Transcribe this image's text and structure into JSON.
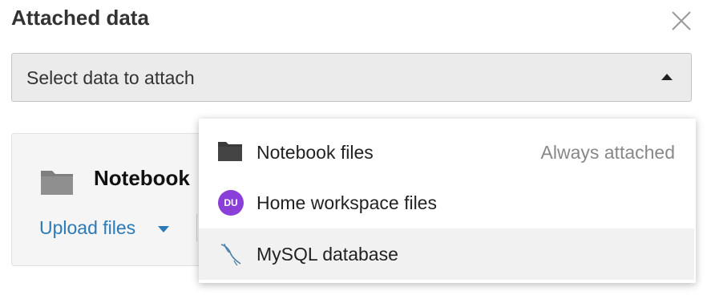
{
  "dialog": {
    "title": "Attached data",
    "close_icon": "close-icon"
  },
  "select": {
    "label": "Select data to attach",
    "caret_icon": "caret-up-icon"
  },
  "card": {
    "title": "Notebook",
    "icon": "folder-icon",
    "upload_label": "Upload files",
    "upload_caret_icon": "caret-down-icon"
  },
  "menu": {
    "items": [
      {
        "label": "Notebook files",
        "aside": "Always attached",
        "icon": "folder-icon"
      },
      {
        "label": "Home workspace files",
        "avatar": "DU",
        "avatar_color": "#8a3fd8",
        "icon": "avatar-icon"
      },
      {
        "label": "MySQL database",
        "icon": "mysql-dolphin-icon",
        "highlighted": true
      }
    ]
  },
  "colors": {
    "link": "#2b7ab6",
    "avatar": "#8a3fd8",
    "select_bg": "#ebebeb",
    "hover_bg": "#f1f1f1"
  }
}
